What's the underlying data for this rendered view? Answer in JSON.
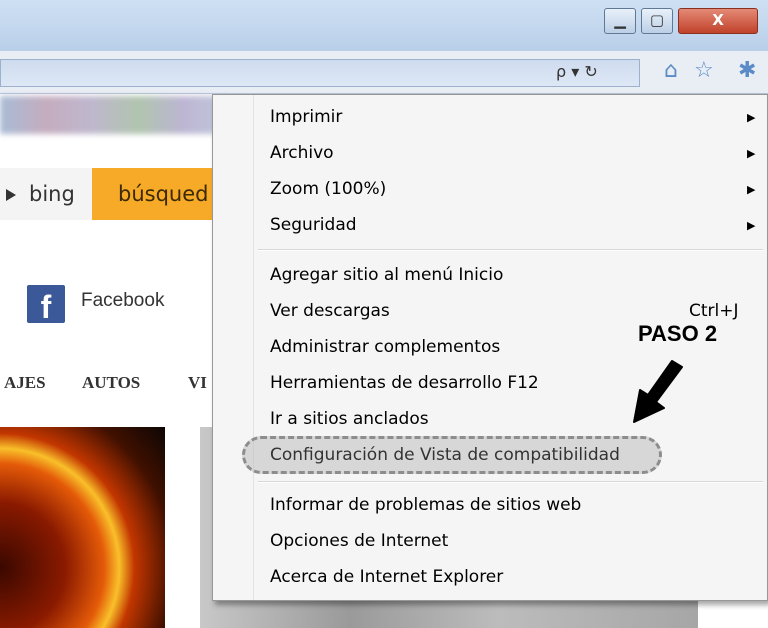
{
  "window": {
    "minimize_glyph": "▁",
    "maximize_glyph": "▢",
    "close_glyph": "X"
  },
  "toolbar": {
    "search_dropdown_glyph": "ρ ▾ ↻",
    "home_icon": "home-icon",
    "favorites_icon": "star-icon",
    "tools_icon": "gear-icon"
  },
  "page": {
    "bing_label": "bing",
    "search_label": "búsqued",
    "facebook_label": "Facebook",
    "nav": [
      "AJES",
      "AUTOS",
      "VI"
    ]
  },
  "menu": {
    "items": [
      {
        "label": "Imprimir",
        "submenu": true
      },
      {
        "label": "Archivo",
        "submenu": true
      },
      {
        "label": "Zoom (100%)",
        "submenu": true
      },
      {
        "label": "Seguridad",
        "submenu": true
      },
      {
        "label": "Agregar sitio al menú Inicio"
      },
      {
        "label": "Ver descargas",
        "shortcut": "Ctrl+J"
      },
      {
        "label": "Administrar complementos"
      },
      {
        "label": "Herramientas de desarrollo F12"
      },
      {
        "label": "Ir a sitios anclados"
      },
      {
        "label": "Configuración de Vista de compatibilidad"
      },
      {
        "label": "Informar de problemas de sitios web"
      },
      {
        "label": "Opciones de Internet"
      },
      {
        "label": "Acerca de Internet Explorer"
      }
    ]
  },
  "annotation": {
    "label": "PASO 2"
  },
  "colors": {
    "accent_orange": "#f7a928",
    "facebook_blue": "#3b5998",
    "close_red": "#c1412a"
  }
}
